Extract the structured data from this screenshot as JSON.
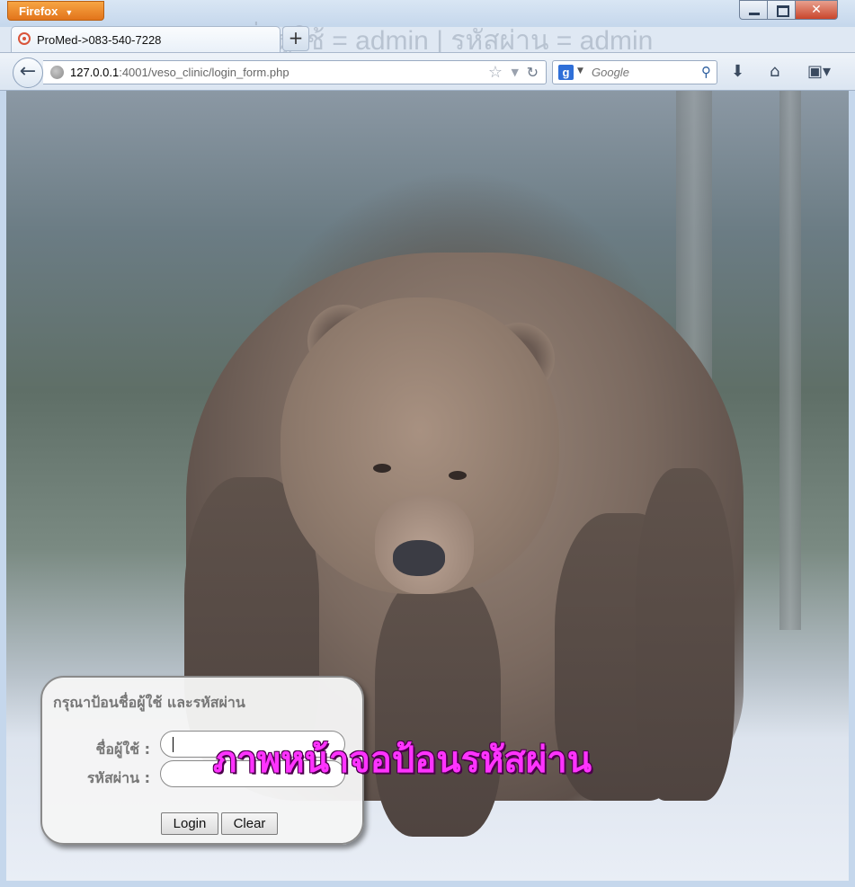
{
  "browser": {
    "menu_button": "Firefox",
    "ghost_title": "ชื่อผู้ใช้ = admin | รหัสผ่าน = admin",
    "tab_title": "ProMed->083-540-7228",
    "new_tab": "+",
    "url_host": "127.0.0.1",
    "url_rest": ":4001/veso_clinic/login_form.php",
    "search_placeholder": "Google",
    "search_engine": "g"
  },
  "page": {
    "caption": "ภาพหน้าจอป้อนรหัสผ่าน",
    "login": {
      "heading": "กรุณาป้อนชื่อผู้ใช้ และรหัสผ่าน",
      "username_label": "ชื่อผู้ใช้ :",
      "password_label": "รหัสผ่าน :",
      "username_value": "",
      "password_value": "",
      "login_button": "Login",
      "clear_button": "Clear"
    }
  },
  "colors": {
    "caption": "#ff33ff",
    "firefox_button": "#e2741b"
  }
}
